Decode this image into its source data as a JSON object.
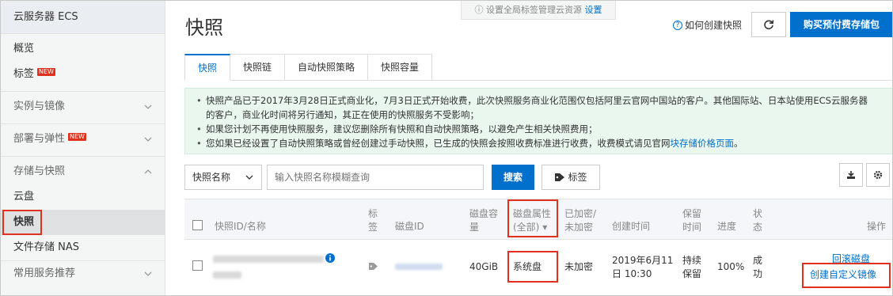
{
  "sidebar": {
    "title": "云服务器 ECS",
    "items": [
      {
        "label": "概览"
      },
      {
        "label": "标签",
        "badge": "NEW"
      },
      {
        "label": "实例与镜像"
      },
      {
        "label": "部署与弹性",
        "badge": "NEW"
      },
      {
        "label": "存储与快照"
      },
      {
        "label": "云盘"
      },
      {
        "label": "快照"
      },
      {
        "label": "文件存储 NAS"
      },
      {
        "label": "常用服务推荐"
      }
    ]
  },
  "header": {
    "title": "快照",
    "global_tip": "设置全局标签管理云资源",
    "global_tip_link": "设置",
    "help_link": "如何创建快照",
    "buy_button": "购买预付费存储包"
  },
  "tabs": [
    {
      "label": "快照"
    },
    {
      "label": "快照链"
    },
    {
      "label": "自动快照策略"
    },
    {
      "label": "快照容量"
    }
  ],
  "notice": {
    "line1": "快照产品已于2017年3月28日正式商业化，7月3日正式开始收费，此次快照服务商业化范围仅包括阿里云官网中国站的客户。其他国际站、日本站使用ECS云服务器",
    "line1b": "的客户，商业化时间将另行通知，其正在使用的快照服务不受影响；",
    "line2": "如果您计划不再使用快照服务，建议您删除所有快照和自动快照策略，以避免产生相关快照费用；",
    "line3": "您如果已经设置了自动快照策略或曾经创建过手动快照，已生成的快照会按照收费标准进行收费，收费模式请见官网",
    "line3_link": "块存储价格页面",
    "line3_end": "。"
  },
  "filter": {
    "select_value": "快照名称",
    "search_placeholder": "输入快照名称模糊查询",
    "search_button": "搜索",
    "tag_button": "标签"
  },
  "table": {
    "headers": {
      "id_name": "快照ID/名称",
      "tag_1": "标",
      "tag_2": "签",
      "disk_id": "磁盘ID",
      "disk_cap_1": "磁盘容",
      "disk_cap_2": "量",
      "disk_attr_1": "磁盘属性",
      "disk_attr_2": "(全部)",
      "encrypted_1": "已加密/",
      "encrypted_2": "未加密",
      "created": "创建时间",
      "retention_1": "保留",
      "retention_2": "时间",
      "progress": "进度",
      "status_1": "状",
      "status_2": "态",
      "actions": "操作"
    },
    "rows": [
      {
        "disk_capacity": "40GiB",
        "disk_attr": "系统盘",
        "encrypted": "未加密",
        "created_1": "2019年6月11",
        "created_2": "日 10:30",
        "retention_1": "持续",
        "retention_2": "保留",
        "progress": "100%",
        "status_1": "成",
        "status_2": "功",
        "action_rollback": "回滚磁盘",
        "action_create_image": "创建自定义镜像"
      }
    ]
  },
  "colors": {
    "primary": "#0070cc",
    "highlight": "#e0301e",
    "notice_bg": "#e9f7ef"
  }
}
